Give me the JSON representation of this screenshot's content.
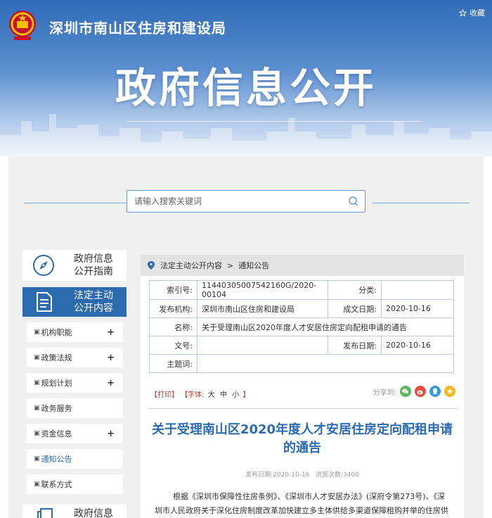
{
  "header": {
    "site_title": "深圳市南山区住房和建设局",
    "favorite_label": "收藏",
    "banner_title": "政府信息公开"
  },
  "search": {
    "placeholder": "请输入搜索关键词"
  },
  "sidebar": {
    "cards": [
      {
        "line1": "政府信息",
        "line2": "公开指南",
        "icon": "compass-icon"
      },
      {
        "line1": "法定主动",
        "line2": "公开内容",
        "icon": "document-icon",
        "active": true
      },
      {
        "line1": "政府信息",
        "icon": "document-stack-icon"
      }
    ],
    "items": [
      {
        "label": "机构职能",
        "expandable": true
      },
      {
        "label": "政策法规",
        "expandable": true
      },
      {
        "label": "规划计划",
        "expandable": true
      },
      {
        "label": "政务服务",
        "expandable": false
      },
      {
        "label": "资金信息",
        "expandable": true
      },
      {
        "label": "通知公告",
        "expandable": false,
        "active": true
      },
      {
        "label": "联系方式",
        "expandable": false
      }
    ],
    "plus_symbol": "+"
  },
  "breadcrumb": {
    "items": [
      "法定主动公开内容",
      "通知公告"
    ],
    "separator": ">"
  },
  "meta": {
    "index_label": "索引号:",
    "index_value": "11440305007542160G/2020-00104",
    "category_label": "分类:",
    "category_value": "",
    "publisher_label": "发布机构:",
    "publisher_value": "深圳市南山区住房和建设局",
    "created_label": "成文日期:",
    "created_value": "2020-10-16",
    "name_label": "名称:",
    "name_value": "关于受理南山区2020年度人才安居住房定向配租申请的通告",
    "doc_no_label": "文号:",
    "doc_no_value": "",
    "publish_label": "发布日期:",
    "publish_value": "2020-10-16",
    "subject_label": "主题词:",
    "subject_value": ""
  },
  "toolbar": {
    "print": "【打印】",
    "font_prefix": "【字体:",
    "font_large": "大",
    "font_medium": "中",
    "font_small": "小",
    "font_suffix": "】",
    "share_label": "分享到:",
    "share_targets": [
      "wechat-icon",
      "weibo-icon",
      "qq-icon",
      "qzone-icon"
    ]
  },
  "article": {
    "title": "关于受理南山区2020年度人才安居住房定向配租申请的通告",
    "publish_text": "发布日期:2020-10-16",
    "views_text": "浏览次数:3400",
    "body": "根据《深圳市保障性住房条例》、《深圳市人才安居办法》(深府令第273号)、《深圳市人民政府关于深化住房制度改革加快建立多主体供给多渠道保障租购并举的住房供应与保障体系的意"
  },
  "colors": {
    "accent": "#2c6bb0",
    "panel_bg": "#f0f0f0",
    "toolbar_red": "#c0392b"
  }
}
